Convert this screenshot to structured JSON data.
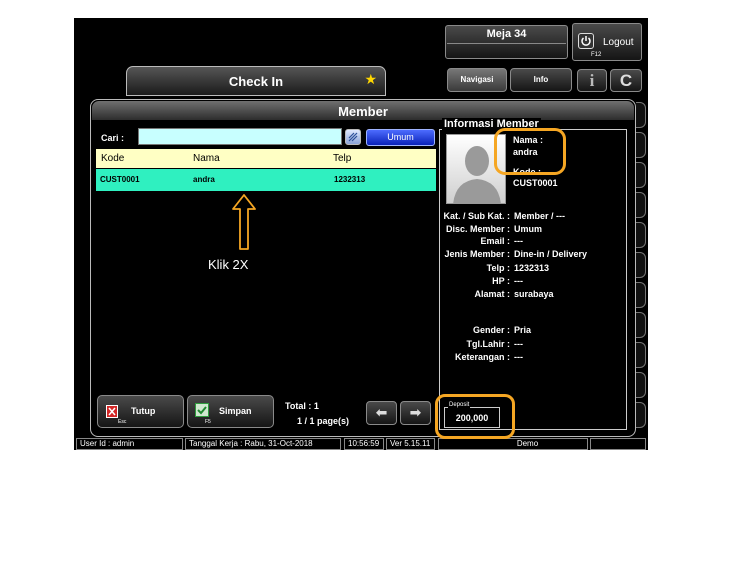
{
  "header": {
    "table_label": "Meja 34",
    "logout_label": "Logout",
    "logout_key": "F12",
    "nav_label": "Navigasi",
    "info_label": "Info",
    "info_icon": "i",
    "clear_icon": "C",
    "checkin_label": "Check In",
    "star_icon": "★"
  },
  "member_panel": {
    "title": "Member",
    "search_label": "Cari :",
    "search_value": "",
    "category_button": "Umum",
    "columns": [
      "Kode",
      "Nama",
      "Telp"
    ],
    "rows": [
      {
        "kode": "CUST0001",
        "nama": "andra",
        "telp": "1232313"
      }
    ]
  },
  "annotation": {
    "instruction": "Klik 2X",
    "accent_color": "#f5a623"
  },
  "info_panel": {
    "title": "Informasi Member",
    "name_label": "Nama :",
    "name_value": "andra",
    "code_label": "Kode :",
    "code_value": "CUST0001",
    "fields": [
      {
        "label": "Kat. / Sub Kat. :",
        "value": "Member / ---"
      },
      {
        "label": "Disc. Member :",
        "value": "Umum"
      },
      {
        "label": "Email :",
        "value": "---"
      },
      {
        "label": "Jenis Member :",
        "value": "Dine-in / Delivery"
      },
      {
        "label": "Telp :",
        "value": "1232313"
      },
      {
        "label": "HP :",
        "value": "---"
      },
      {
        "label": "Alamat :",
        "value": "surabaya"
      },
      {
        "label": "Gender :",
        "value": "Pria"
      },
      {
        "label": "Tgl.Lahir :",
        "value": "---"
      },
      {
        "label": "Keterangan :",
        "value": "---"
      }
    ],
    "deposit_label": "Deposit",
    "deposit_value": "200,000"
  },
  "footer": {
    "tutup_label": "Tutup",
    "tutup_key": "Esc",
    "simpan_label": "Simpan",
    "simpan_key": "F5",
    "total_text": "Total : 1",
    "page_text": "1 / 1 page(s)",
    "prev_icon": "⬅",
    "next_icon": "➡"
  },
  "statusbar": {
    "user": "User Id : admin",
    "work_date": "Tanggal Kerja : Rabu, 31-Oct-2018",
    "time": "10:56:59",
    "version": "Ver 5.15.11",
    "mode": "Demo"
  }
}
